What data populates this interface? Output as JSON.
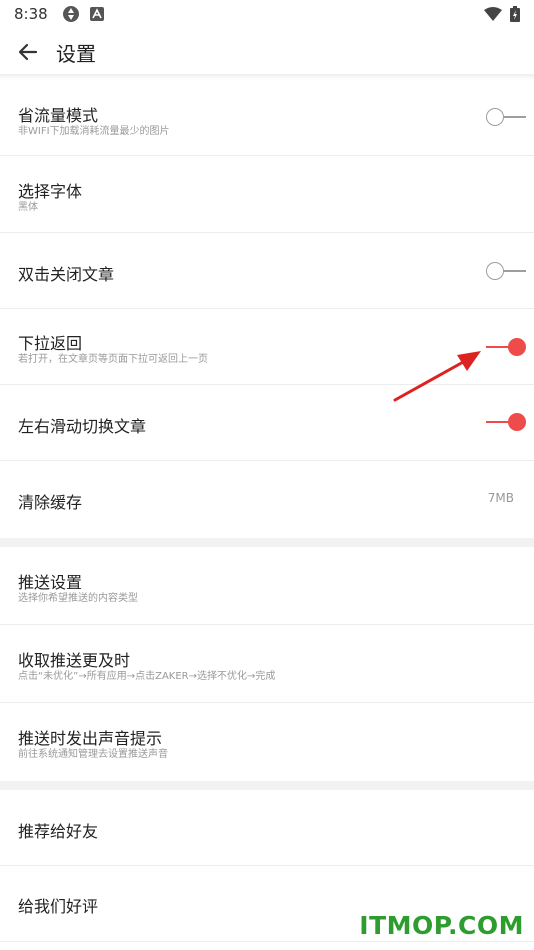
{
  "status_bar": {
    "time": "8:38",
    "left_icons": [
      "sync-icon",
      "a-icon"
    ],
    "right_icons": [
      "wifi-icon",
      "battery-icon"
    ]
  },
  "app_bar": {
    "back_icon": "arrow-left-icon",
    "title": "设置"
  },
  "settings": {
    "data_saver": {
      "title": "省流量模式",
      "subtitle": "非WIFI下加载消耗流量最少的图片",
      "toggle_on": false
    },
    "font": {
      "title": "选择字体",
      "subtitle": "黑体"
    },
    "double_tap_close": {
      "title": "双击关闭文章",
      "toggle_on": false
    },
    "pull_back": {
      "title": "下拉返回",
      "subtitle": "若打开，在文章页等页面下拉可返回上一页",
      "toggle_on": true
    },
    "swipe_switch": {
      "title": "左右滑动切换文章",
      "toggle_on": true
    },
    "clear_cache": {
      "title": "清除缓存",
      "value": "7MB"
    },
    "push_settings": {
      "title": "推送设置",
      "subtitle": "选择你希望推送的内容类型"
    },
    "receive_push": {
      "title": "收取推送更及时",
      "subtitle": "点击“未优化”→所有应用→点击ZAKER→选择不优化→完成"
    },
    "push_sound": {
      "title": "推送时发出声音提示",
      "subtitle": "前往系统通知管理去设置推送声音"
    },
    "recommend": {
      "title": "推荐给好友"
    },
    "rate": {
      "title": "给我们好评"
    }
  },
  "annotation": {
    "arrow_color": "#dd2222"
  },
  "watermark": {
    "text": "ITMOP.COM"
  },
  "colors": {
    "accent": "#ee4b4b",
    "watermark": "#2e9c2e"
  }
}
